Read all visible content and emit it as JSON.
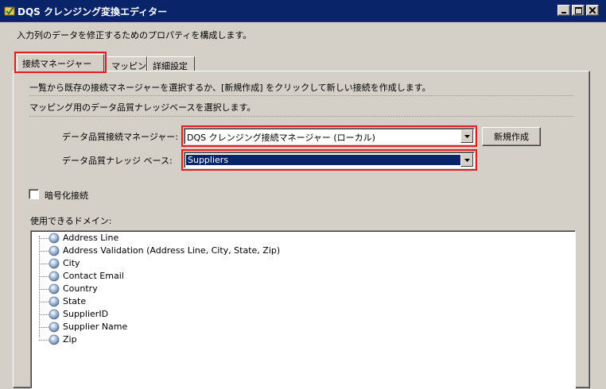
{
  "window": {
    "title": "DQS クレンジング変換エディター",
    "description": "入力列のデータを修正するためのプロパティを構成します。"
  },
  "tabs": [
    {
      "label": "接続マネージャー",
      "active": true
    },
    {
      "label": "マッピング",
      "active": false
    },
    {
      "label": "詳細設定",
      "active": false
    }
  ],
  "connection_tab": {
    "info_line_1": "一覧から既存の接続マネージャーを選択するか、[新規作成] をクリックして新しい接続を作成します。",
    "info_line_2": "マッピング用のデータ品質ナレッジベースを選択します。",
    "connection_manager_label": "データ品質接続マネージャー:",
    "connection_manager_value": "DQS クレンジング接続マネージャー (ローカル)",
    "new_button_label": "新規作成",
    "knowledge_base_label": "データ品質ナレッジ ベース:",
    "knowledge_base_value": "Suppliers",
    "encrypt_label": "暗号化接続",
    "encrypt_checked": false,
    "domains_label": "使用できるドメイン:",
    "domains": [
      "Address Line",
      "Address Validation (Address Line, City, State, Zip)",
      "City",
      "Contact Email",
      "Country",
      "State",
      "SupplierID",
      "Supplier Name",
      "Zip"
    ]
  },
  "colors": {
    "title_bar": "#0a246a",
    "highlight_box": "#e31d23",
    "dialog_bg": "#d4d0c8"
  }
}
